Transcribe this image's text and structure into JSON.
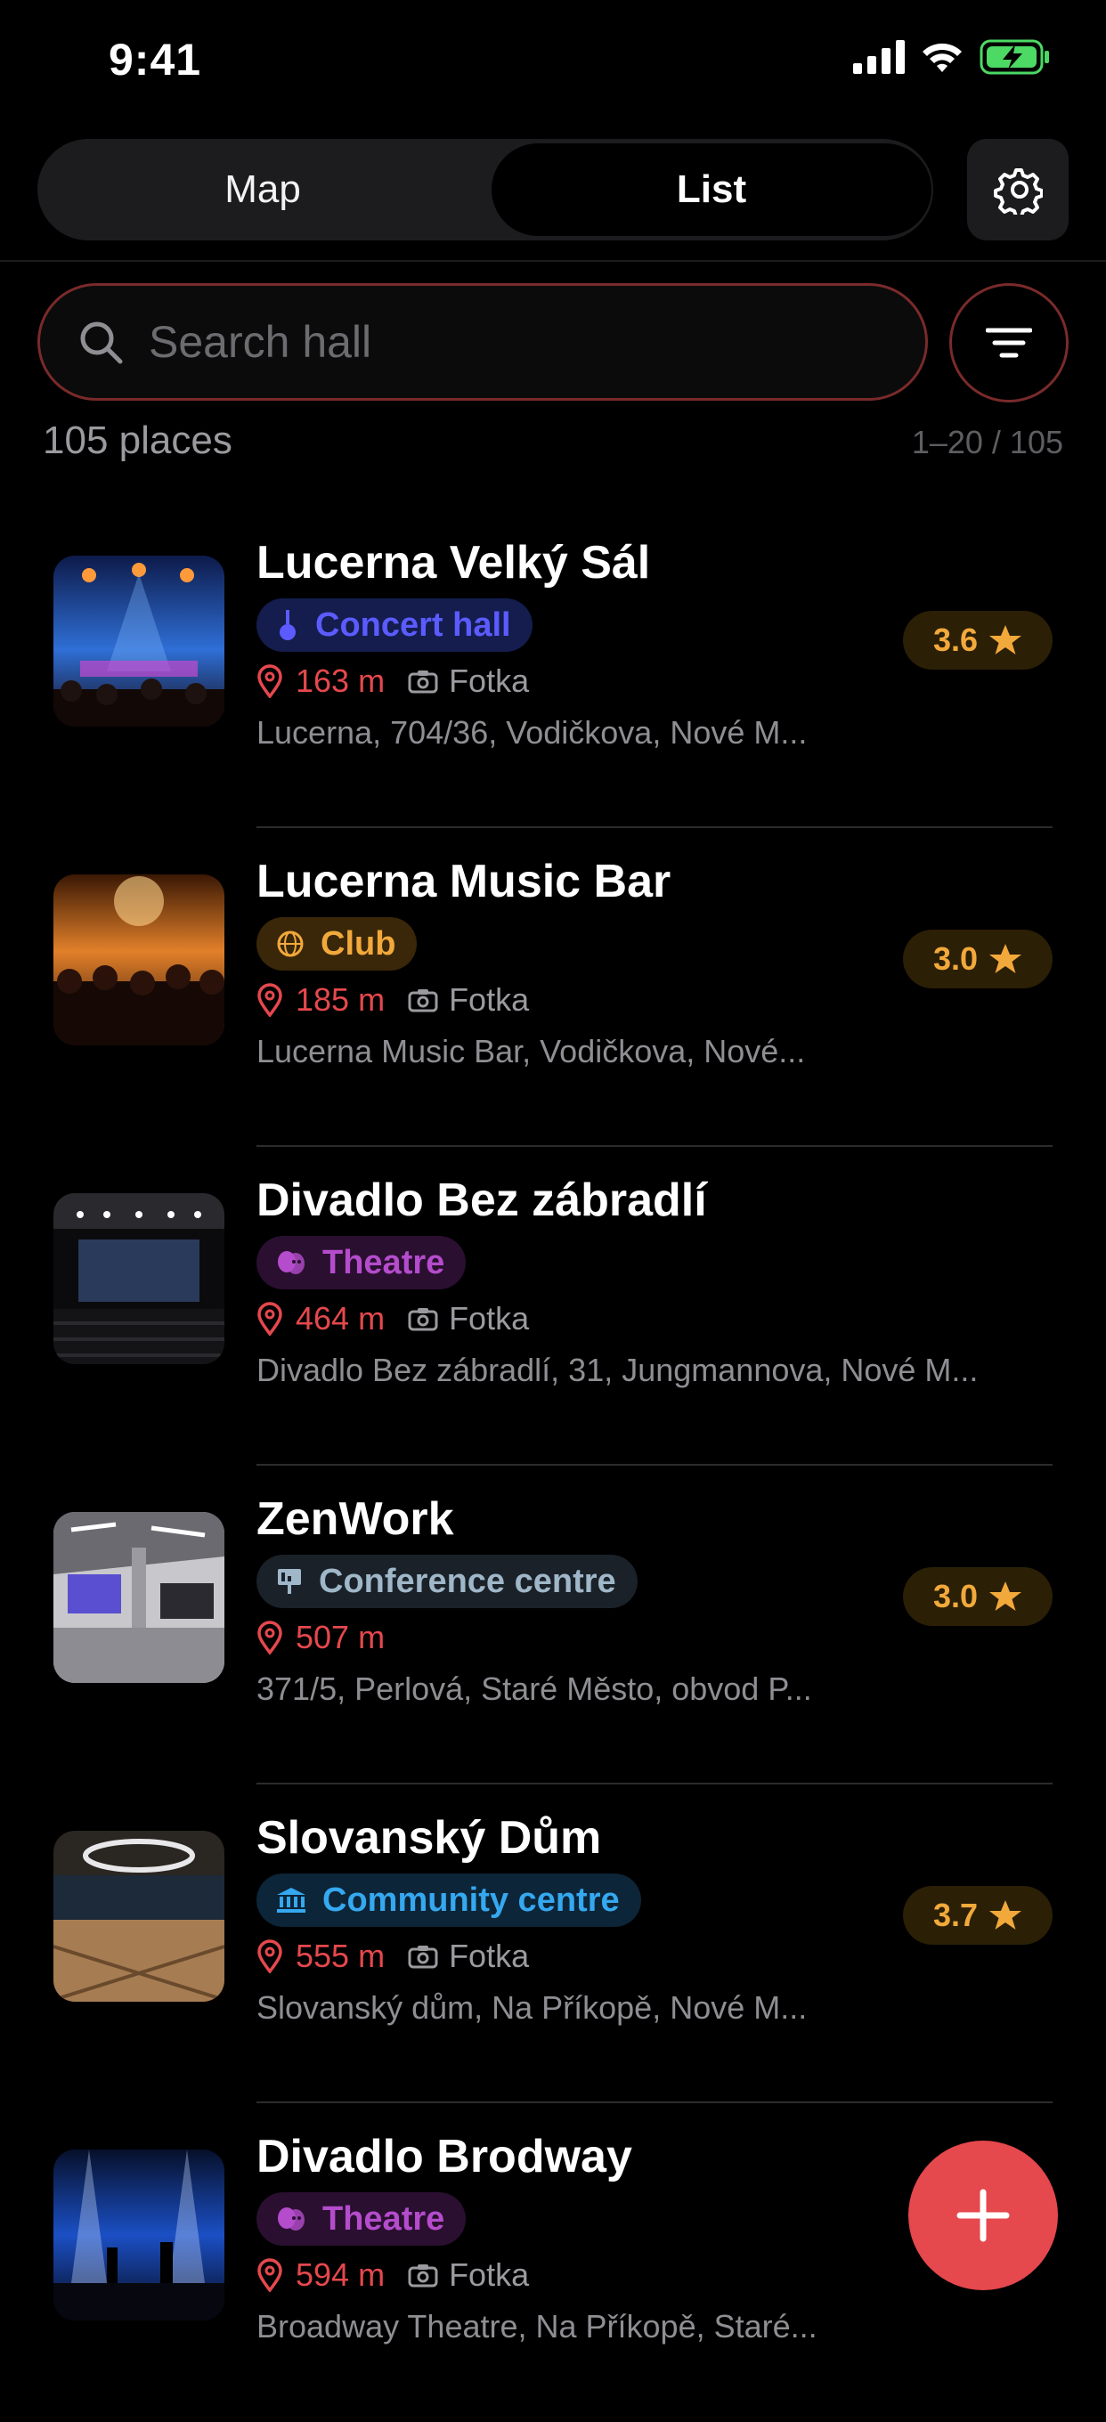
{
  "status_bar": {
    "time": "9:41"
  },
  "header": {
    "tabs": [
      {
        "label": "Map",
        "selected": false
      },
      {
        "label": "List",
        "selected": true
      }
    ]
  },
  "search": {
    "placeholder": "Search hall",
    "value": ""
  },
  "summary": {
    "count": "105 places",
    "pagination": "1–20 / 105"
  },
  "venues": [
    {
      "name": "Lucerna Velký Sál",
      "category": "Concert hall",
      "category_icon": "guitar-icon",
      "distance": "163 m",
      "photo_label": "Fotka",
      "address": "Lucerna, 704/36, Vodičkova, Nové M...",
      "rating": "3.6"
    },
    {
      "name": "Lucerna Music Bar",
      "category": "Club",
      "category_icon": "disco-ball-icon",
      "distance": "185 m",
      "photo_label": "Fotka",
      "address": "Lucerna Music Bar, Vodičkova, Nové...",
      "rating": "3.0"
    },
    {
      "name": "Divadlo Bez zábradlí",
      "category": "Theatre",
      "category_icon": "theatre-masks-icon",
      "distance": "464 m",
      "photo_label": "Fotka",
      "address": "Divadlo Bez zábradlí, 31, Jungmannova, Nové M...",
      "rating": ""
    },
    {
      "name": "ZenWork",
      "category": "Conference centre",
      "category_icon": "presentation-icon",
      "distance": "507 m",
      "photo_label": "",
      "address": "371/5, Perlová, Staré Město, obvod P...",
      "rating": "3.0"
    },
    {
      "name": "Slovanský Dům",
      "category": "Community centre",
      "category_icon": "building-icon",
      "distance": "555 m",
      "photo_label": "Fotka",
      "address": "Slovanský dům, Na Příkopě, Nové M...",
      "rating": "3.7"
    },
    {
      "name": "Divadlo Brodway",
      "category": "Theatre",
      "category_icon": "theatre-masks-icon",
      "distance": "594 m",
      "photo_label": "Fotka",
      "address": "Broadway Theatre, Na Příkopě, Staré...",
      "rating": ""
    }
  ],
  "colors": {
    "accent": "#e5484d",
    "rating_text": "#f2a93b",
    "concert_hall": "#5b5bff",
    "club": "#f2a93b",
    "theatre": "#b44ccc",
    "conference_centre": "#9fb7c8",
    "community_centre": "#35a8f0"
  }
}
